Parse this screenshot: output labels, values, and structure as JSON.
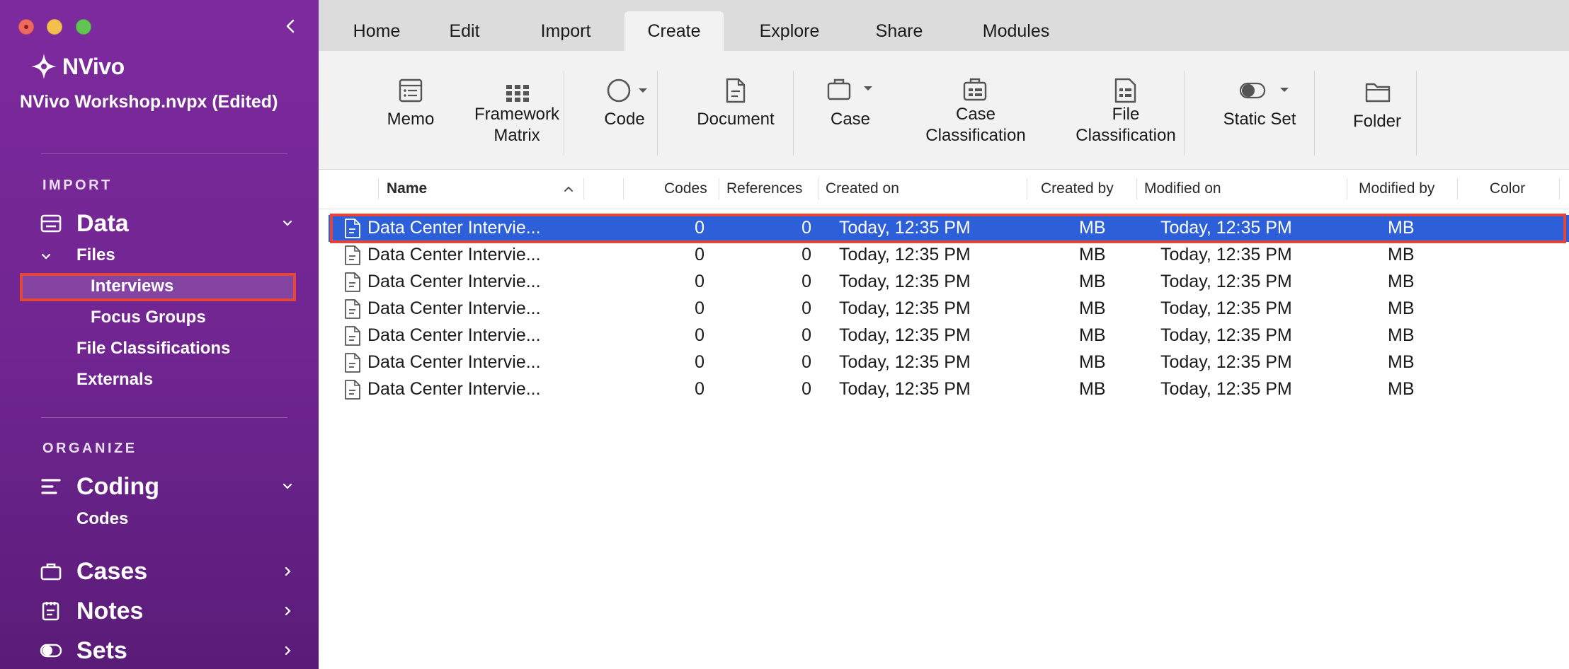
{
  "app": {
    "name": "NVivo",
    "project_title": "NVivo Workshop.nvpx (Edited)"
  },
  "sidebar": {
    "import_label": "IMPORT",
    "organize_label": "ORGANIZE",
    "data": {
      "label": "Data",
      "files_label": "Files",
      "files_children": [
        "Interviews",
        "Focus Groups"
      ],
      "others": [
        "File Classifications",
        "Externals"
      ]
    },
    "coding": {
      "label": "Coding",
      "children": [
        "Codes"
      ]
    },
    "cases": {
      "label": "Cases"
    },
    "notes": {
      "label": "Notes"
    },
    "sets": {
      "label": "Sets"
    }
  },
  "tabs": [
    "Home",
    "Edit",
    "Import",
    "Create",
    "Explore",
    "Share",
    "Modules"
  ],
  "active_tab": "Create",
  "ribbon": {
    "memo": [
      "Memo"
    ],
    "framework_matrix": [
      "Framework",
      "Matrix"
    ],
    "code": [
      "Code"
    ],
    "document": [
      "Document"
    ],
    "case": [
      "Case"
    ],
    "case_classification": [
      "Case",
      "Classification"
    ],
    "file_classification": [
      "File",
      "Classification"
    ],
    "static_set": [
      "Static Set"
    ],
    "folder": [
      "Folder"
    ]
  },
  "table": {
    "columns": {
      "name": "Name",
      "codes": "Codes",
      "references": "References",
      "created_on": "Created on",
      "created_by": "Created by",
      "modified_on": "Modified on",
      "modified_by": "Modified by",
      "color": "Color"
    },
    "rows": [
      {
        "name": "Data Center Intervie...",
        "codes": "0",
        "references": "0",
        "created_on": "Today, 12:35 PM",
        "created_by": "MB",
        "modified_on": "Today, 12:35 PM",
        "modified_by": "MB"
      },
      {
        "name": "Data Center Intervie...",
        "codes": "0",
        "references": "0",
        "created_on": "Today, 12:35 PM",
        "created_by": "MB",
        "modified_on": "Today, 12:35 PM",
        "modified_by": "MB"
      },
      {
        "name": "Data Center Intervie...",
        "codes": "0",
        "references": "0",
        "created_on": "Today, 12:35 PM",
        "created_by": "MB",
        "modified_on": "Today, 12:35 PM",
        "modified_by": "MB"
      },
      {
        "name": "Data Center Intervie...",
        "codes": "0",
        "references": "0",
        "created_on": "Today, 12:35 PM",
        "created_by": "MB",
        "modified_on": "Today, 12:35 PM",
        "modified_by": "MB"
      },
      {
        "name": "Data Center Intervie...",
        "codes": "0",
        "references": "0",
        "created_on": "Today, 12:35 PM",
        "created_by": "MB",
        "modified_on": "Today, 12:35 PM",
        "modified_by": "MB"
      },
      {
        "name": "Data Center Intervie...",
        "codes": "0",
        "references": "0",
        "created_on": "Today, 12:35 PM",
        "created_by": "MB",
        "modified_on": "Today, 12:35 PM",
        "modified_by": "MB"
      },
      {
        "name": "Data Center Intervie...",
        "codes": "0",
        "references": "0",
        "created_on": "Today, 12:35 PM",
        "created_by": "MB",
        "modified_on": "Today, 12:35 PM",
        "modified_by": "MB"
      }
    ],
    "selected_row": 0
  },
  "colors": {
    "sidebar": "#7d2a9e",
    "selection": "#2c5fd8",
    "highlight_outline": "#e2473a"
  }
}
